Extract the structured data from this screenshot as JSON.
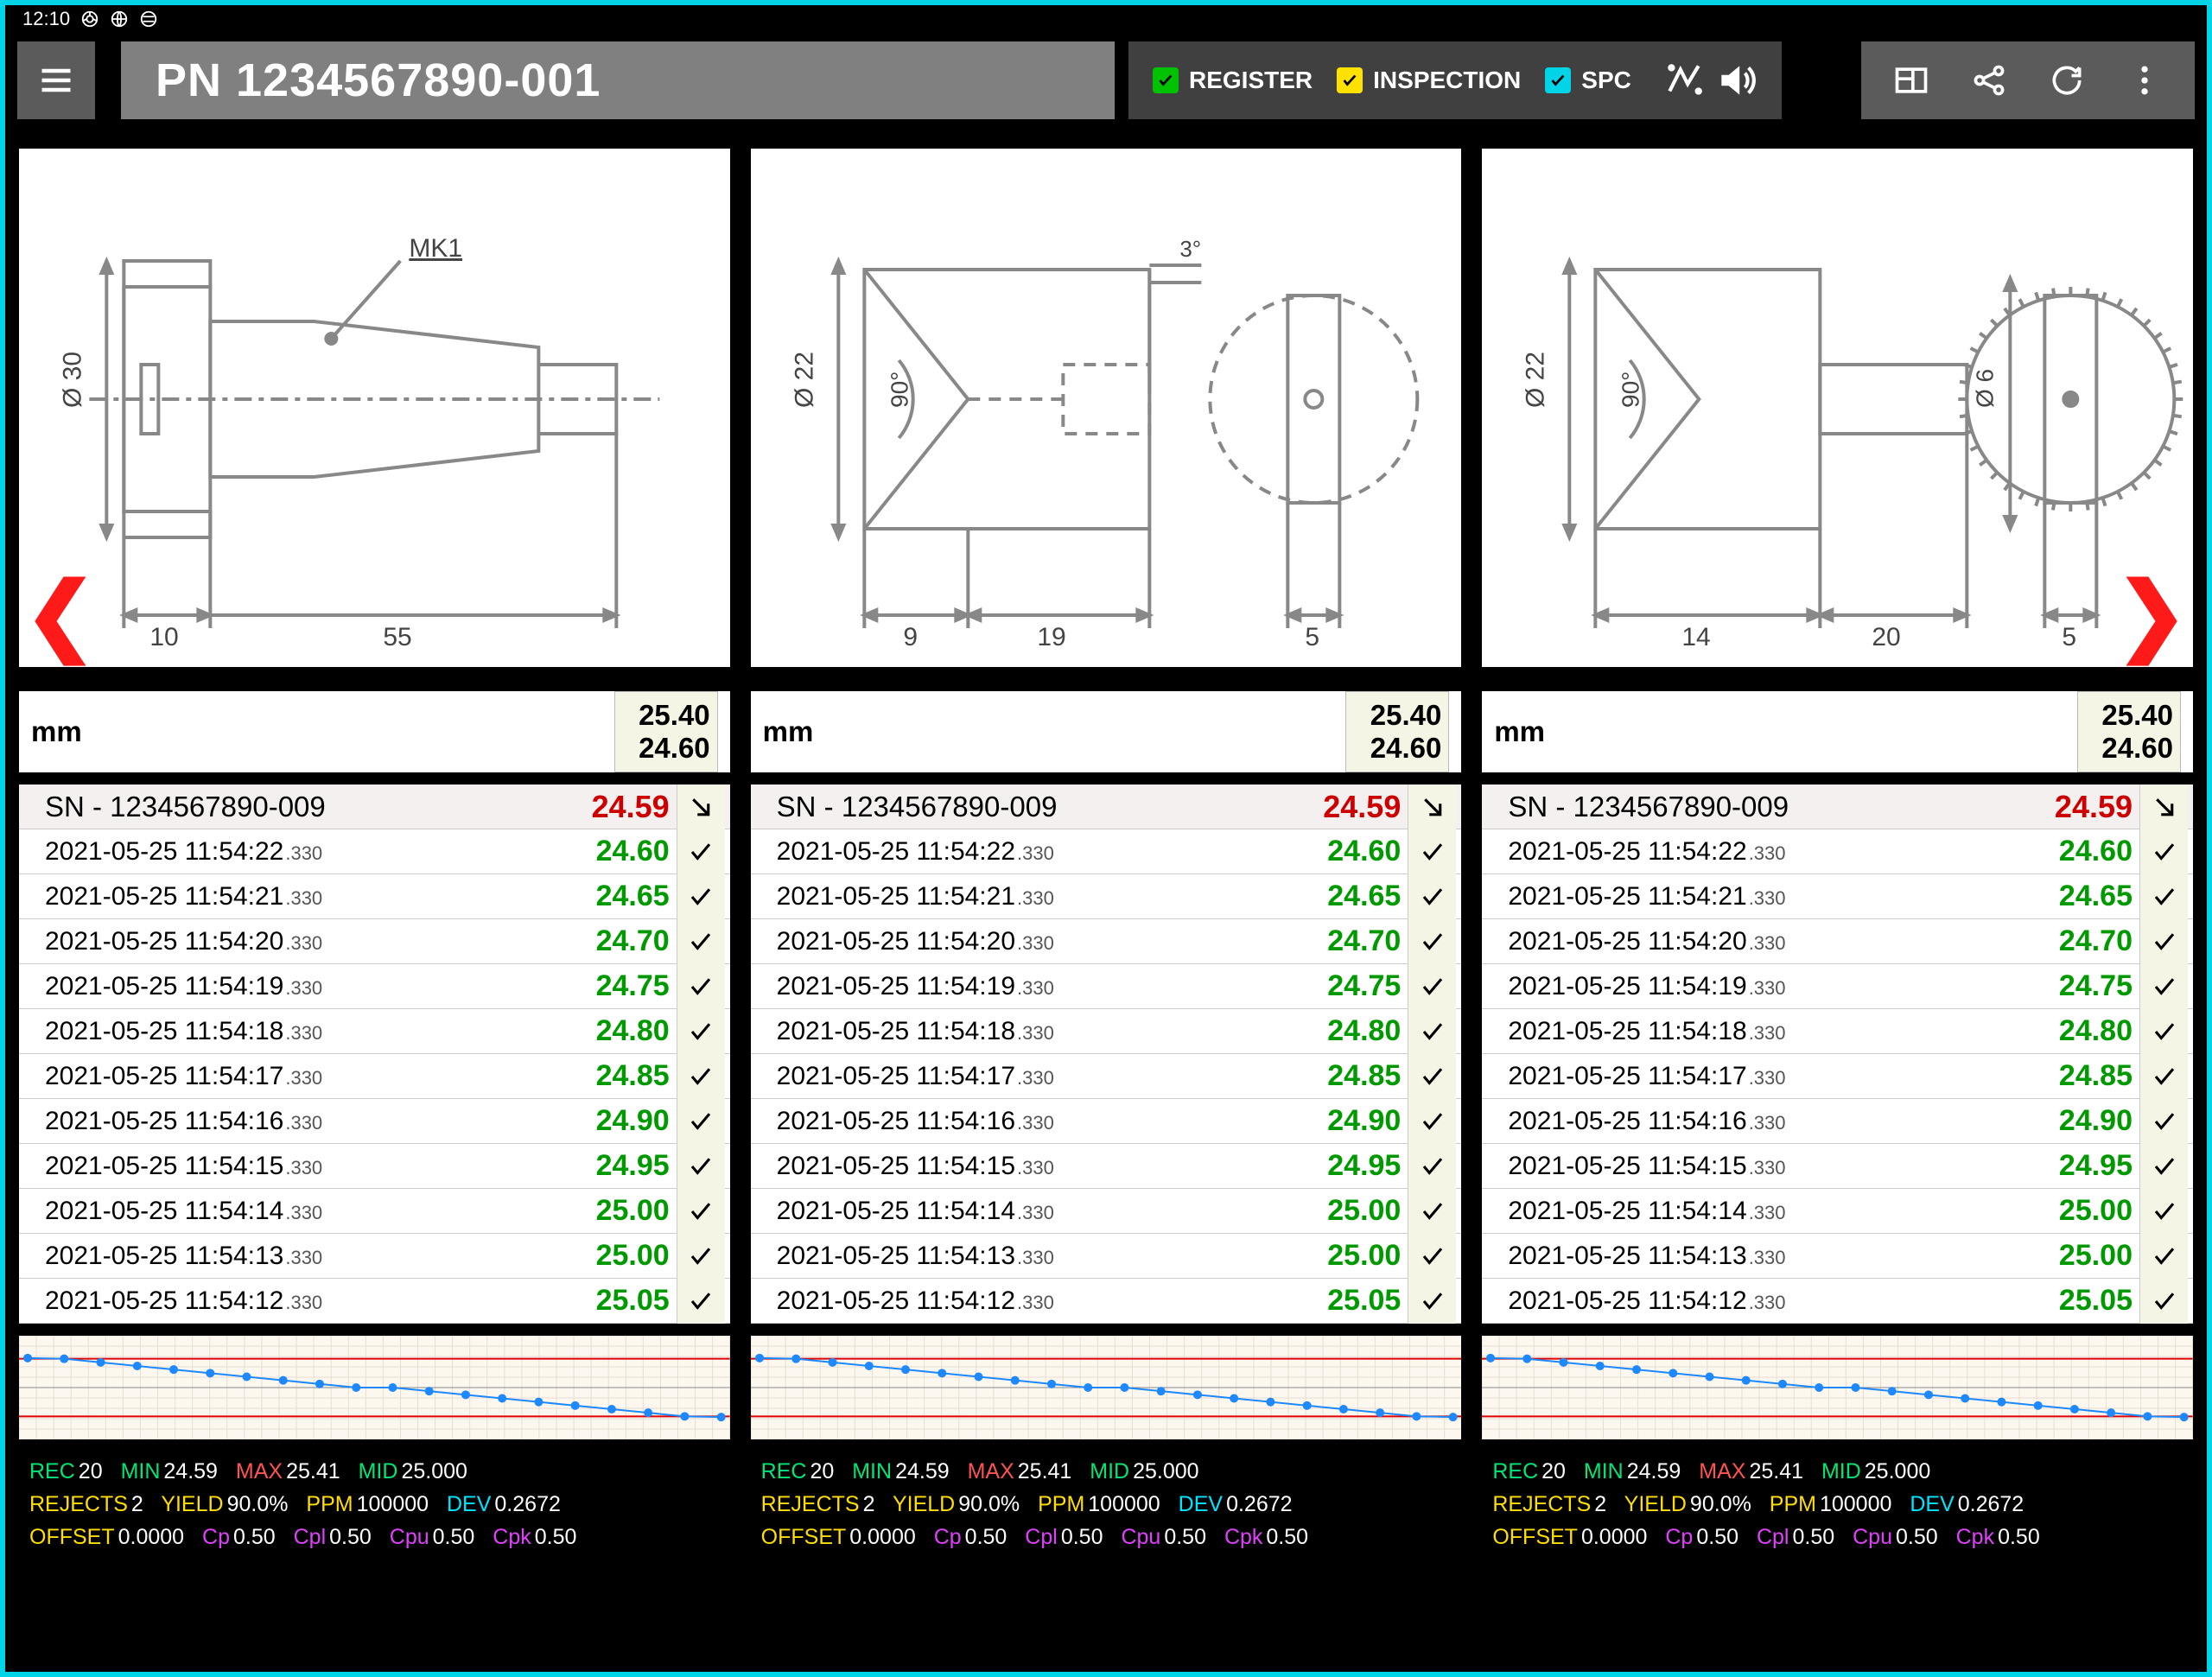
{
  "status_bar": {
    "time": "12:10"
  },
  "title": "PN 1234567890-001",
  "toggles": {
    "register": "REGISTER",
    "inspection": "INSPECTION",
    "spc": "SPC"
  },
  "drawing_labels": {
    "panel0": {
      "mk": "MK1",
      "d30": "Ø 30",
      "l10": "10",
      "l55": "55"
    },
    "panel1": {
      "d22": "Ø 22",
      "a90": "90°",
      "l9": "9",
      "l19": "19",
      "a3": "3°",
      "l5": "5"
    },
    "panel2": {
      "d22": "Ø 22",
      "a90": "90°",
      "l14": "14",
      "l20": "20",
      "d6": "Ø 6",
      "l5": "5"
    }
  },
  "unit": "mm",
  "tol_upper": "25.40",
  "tol_lower": "24.60",
  "sn_label": "SN - 1234567890-009",
  "sn_value": "24.59",
  "rows": [
    {
      "ts": "2021-05-25 11:54:22",
      "ms": ".330",
      "val": "24.60"
    },
    {
      "ts": "2021-05-25 11:54:21",
      "ms": ".330",
      "val": "24.65"
    },
    {
      "ts": "2021-05-25 11:54:20",
      "ms": ".330",
      "val": "24.70"
    },
    {
      "ts": "2021-05-25 11:54:19",
      "ms": ".330",
      "val": "24.75"
    },
    {
      "ts": "2021-05-25 11:54:18",
      "ms": ".330",
      "val": "24.80"
    },
    {
      "ts": "2021-05-25 11:54:17",
      "ms": ".330",
      "val": "24.85"
    },
    {
      "ts": "2021-05-25 11:54:16",
      "ms": ".330",
      "val": "24.90"
    },
    {
      "ts": "2021-05-25 11:54:15",
      "ms": ".330",
      "val": "24.95"
    },
    {
      "ts": "2021-05-25 11:54:14",
      "ms": ".330",
      "val": "25.00"
    },
    {
      "ts": "2021-05-25 11:54:13",
      "ms": ".330",
      "val": "25.00"
    },
    {
      "ts": "2021-05-25 11:54:12",
      "ms": ".330",
      "val": "25.05"
    }
  ],
  "chart_data": {
    "type": "line",
    "title": "",
    "xlabel": "",
    "ylabel": "",
    "ylim": [
      24.4,
      25.6
    ],
    "limits": {
      "upper": 25.4,
      "lower": 24.6,
      "mid": 25.0
    },
    "x": [
      1,
      2,
      3,
      4,
      5,
      6,
      7,
      8,
      9,
      10,
      11,
      12,
      13,
      14,
      15,
      16,
      17,
      18,
      19,
      20
    ],
    "values": [
      25.41,
      25.4,
      25.35,
      25.3,
      25.25,
      25.2,
      25.15,
      25.1,
      25.05,
      25.0,
      25.0,
      24.95,
      24.9,
      24.85,
      24.8,
      24.75,
      24.7,
      24.65,
      24.6,
      24.59
    ]
  },
  "stats": {
    "rec_lbl": "REC",
    "rec": "20",
    "min_lbl": "MIN",
    "min": "24.59",
    "max_lbl": "MAX",
    "max": "25.41",
    "mid_lbl": "MID",
    "mid": "25.000",
    "rej_lbl": "REJECTS",
    "rej": "2",
    "yield_lbl": "YIELD",
    "yield": "90.0%",
    "ppm_lbl": "PPM",
    "ppm": "100000",
    "dev_lbl": "DEV",
    "dev": "0.2672",
    "off_lbl": "OFFSET",
    "off": "0.0000",
    "cp_lbl": "Cp",
    "cp": "0.50",
    "cpl_lbl": "Cpl",
    "cpl": "0.50",
    "cpu_lbl": "Cpu",
    "cpu": "0.50",
    "cpk_lbl": "Cpk",
    "cpk": "0.50"
  }
}
